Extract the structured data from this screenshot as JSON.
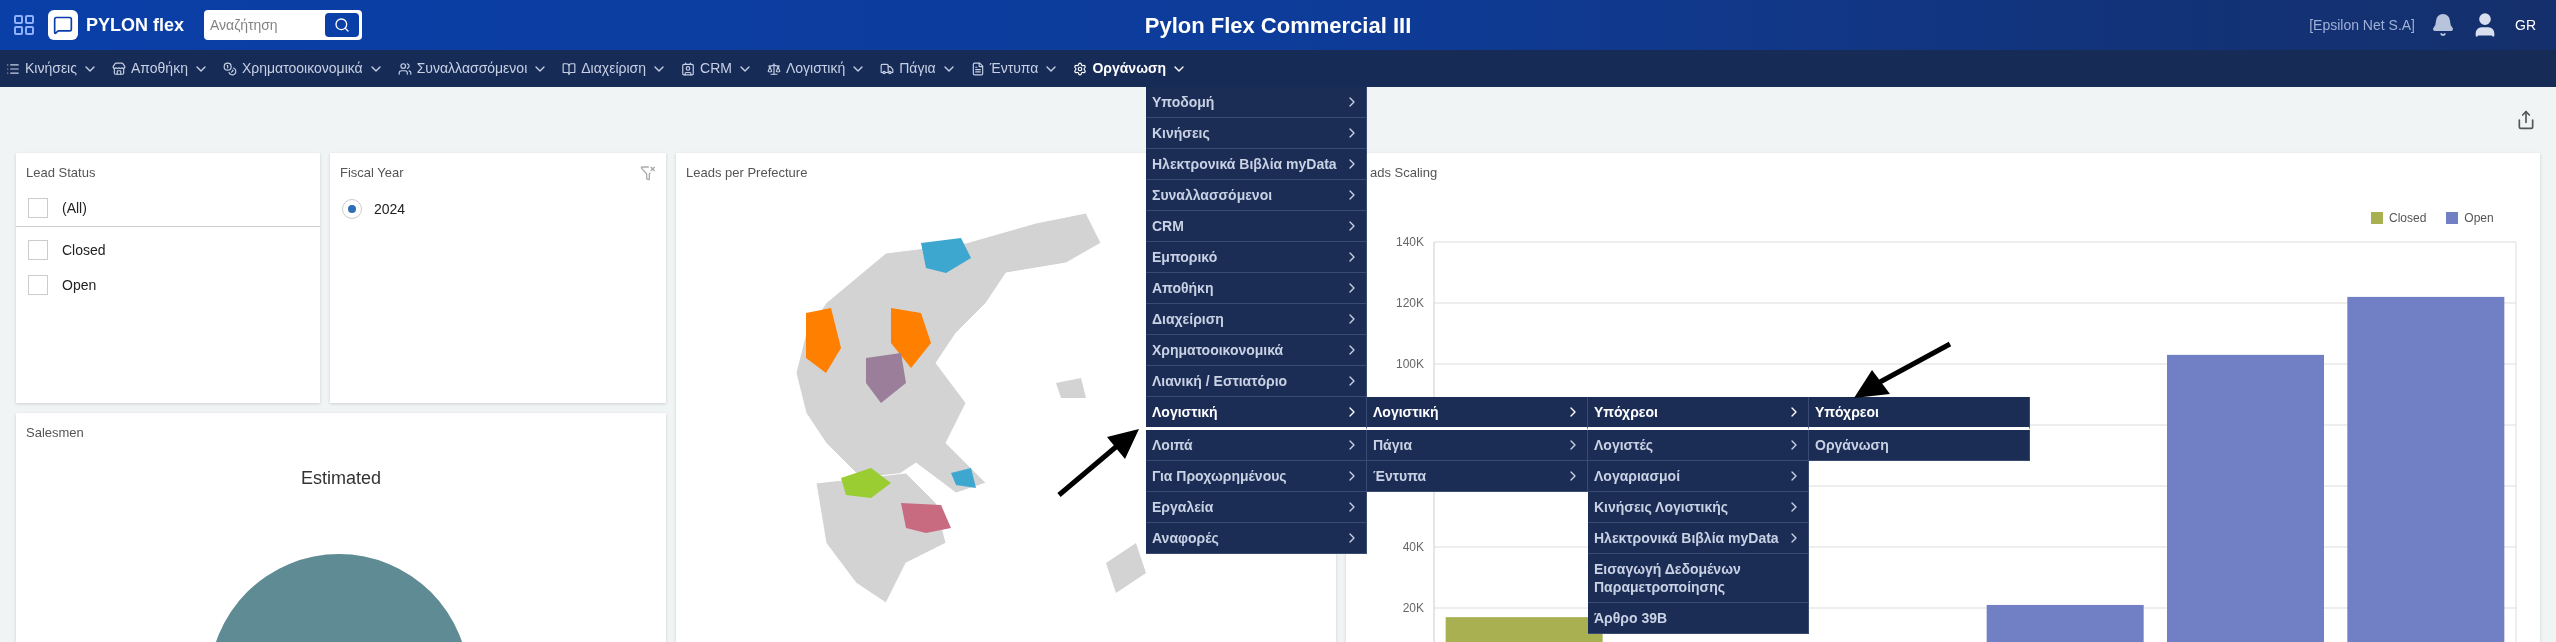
{
  "header": {
    "brand": "PYLON flex",
    "search_placeholder": "Αναζήτηση",
    "title": "Pylon Flex Commercial III",
    "company": "[Epsilon Net S.A]",
    "language": "GR"
  },
  "nav": [
    {
      "label": "Κινήσεις",
      "selected": false
    },
    {
      "label": "Αποθήκη",
      "selected": false
    },
    {
      "label": "Χρηματοοικονομικά",
      "selected": false
    },
    {
      "label": "Συναλλασσόμενοι",
      "selected": false
    },
    {
      "label": "Διαχείριση",
      "selected": false
    },
    {
      "label": "CRM",
      "selected": false
    },
    {
      "label": "Λογιστική",
      "selected": false
    },
    {
      "label": "Πάγια",
      "selected": false
    },
    {
      "label": "Έντυπα",
      "selected": false
    },
    {
      "label": "Οργάνωση",
      "selected": true
    }
  ],
  "menu": [
    {
      "label": "Υποδομή",
      "submenu": true,
      "selected": false
    },
    {
      "label": "Κινήσεις",
      "submenu": true,
      "selected": false
    },
    {
      "label": "Ηλεκτρονικά Βιβλία myData",
      "submenu": true,
      "selected": false
    },
    {
      "label": "Συναλλασσόμενοι",
      "submenu": true,
      "selected": false
    },
    {
      "label": "CRM",
      "submenu": true,
      "selected": false
    },
    {
      "label": "Εμπορικό",
      "submenu": true,
      "selected": false
    },
    {
      "label": "Αποθήκη",
      "submenu": true,
      "selected": false
    },
    {
      "label": "Διαχείριση",
      "submenu": true,
      "selected": false
    },
    {
      "label": "Χρηματοοικονομικά",
      "submenu": true,
      "selected": false
    },
    {
      "label": "Λιανική / Εστιατόριο",
      "submenu": true,
      "selected": false
    },
    {
      "label": "Λογιστική",
      "submenu": true,
      "selected": true,
      "children": [
        {
          "label": "Λογιστική",
          "submenu": true,
          "selected": true,
          "children": [
            {
              "label": "Υπόχρεοι",
              "submenu": true,
              "selected": true,
              "children": [
                {
                  "label": "Υπόχρεοι",
                  "submenu": false,
                  "selected": true
                },
                {
                  "label": "Οργάνωση",
                  "submenu": false,
                  "selected": false
                }
              ]
            },
            {
              "label": "Λογιστές",
              "submenu": true,
              "selected": false
            },
            {
              "label": "Λογαριασμοί",
              "submenu": true,
              "selected": false
            },
            {
              "label": "Κινήσεις Λογιστικής",
              "submenu": true,
              "selected": false
            },
            {
              "label": "Ηλεκτρονικά Βιβλία myData",
              "submenu": true,
              "selected": false
            },
            {
              "label": "Εισαγωγή Δεδομένων Παραμετροποίησης",
              "submenu": false,
              "selected": false
            },
            {
              "label": "Άρθρο 39Β",
              "submenu": false,
              "selected": false
            }
          ]
        },
        {
          "label": "Πάγια",
          "submenu": true,
          "selected": false
        },
        {
          "label": "Έντυπα",
          "submenu": true,
          "selected": false
        }
      ]
    },
    {
      "label": "Λοιπά",
      "submenu": true,
      "selected": false
    },
    {
      "label": "Για Προχωρημένους",
      "submenu": true,
      "selected": false
    },
    {
      "label": "Εργαλεία",
      "submenu": true,
      "selected": false
    },
    {
      "label": "Αναφορές",
      "submenu": true,
      "selected": false
    }
  ],
  "lead_status": {
    "title": "Lead Status",
    "items": [
      {
        "label": "(All)",
        "checked": false
      },
      {
        "label": "Closed",
        "checked": false
      },
      {
        "label": "Open",
        "checked": false
      }
    ]
  },
  "fiscal_year": {
    "title": "Fiscal Year",
    "items": [
      {
        "label": "2024",
        "selected": true
      }
    ]
  },
  "salesmen": {
    "title": "Salesmen",
    "chart_title": "Estimated"
  },
  "map": {
    "title": "Leads per Prefecture"
  },
  "leads_scaling": {
    "title": "ads Scaling",
    "chart_data": {
      "type": "bar",
      "grid": true,
      "ylim": [
        0,
        140000
      ],
      "yticks": [
        {
          "value": 20000,
          "label": "20K"
        },
        {
          "value": 40000,
          "label": "40K"
        },
        {
          "value": 100000,
          "label": "100K"
        },
        {
          "value": 120000,
          "label": "120K"
        },
        {
          "value": 140000,
          "label": "140K"
        }
      ],
      "series": [
        {
          "name": "Closed",
          "color": "#a8b052",
          "values": [
            17000,
            null,
            null,
            null,
            null,
            null
          ]
        },
        {
          "name": "Open",
          "color": "#717fc4",
          "values": [
            null,
            null,
            null,
            21000,
            103000,
            122000
          ]
        }
      ]
    }
  }
}
